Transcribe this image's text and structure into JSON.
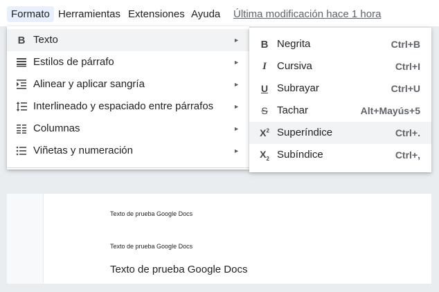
{
  "menubar": {
    "items": [
      "Formato",
      "Herramientas",
      "Extensiones",
      "Ayuda"
    ],
    "last_modified": "Última modificación hace 1 hora"
  },
  "format_menu": {
    "items": [
      {
        "label": "Texto",
        "icon": "bold-b-icon"
      },
      {
        "label": "Estilos de párrafo",
        "icon": "paragraph-styles-icon"
      },
      {
        "label": "Alinear y aplicar sangría",
        "icon": "indent-icon"
      },
      {
        "label": "Interlineado y espaciado entre párrafos",
        "icon": "line-spacing-icon"
      },
      {
        "label": "Columnas",
        "icon": "columns-icon"
      },
      {
        "label": "Viñetas y numeración",
        "icon": "bulleted-list-icon"
      }
    ],
    "arrow": "►"
  },
  "text_submenu": {
    "items": [
      {
        "label": "Negrita",
        "shortcut": "Ctrl+B",
        "icon": "bold-icon"
      },
      {
        "label": "Cursiva",
        "shortcut": "Ctrl+I",
        "icon": "italic-icon"
      },
      {
        "label": "Subrayar",
        "shortcut": "Ctrl+U",
        "icon": "underline-icon"
      },
      {
        "label": "Tachar",
        "shortcut": "Alt+Mayús+5",
        "icon": "strikethrough-icon"
      },
      {
        "label": "Superíndice",
        "shortcut": "Ctrl+.",
        "icon": "superscript-icon"
      },
      {
        "label": "Subíndice",
        "shortcut": "Ctrl+,",
        "icon": "subscript-icon"
      }
    ]
  },
  "document": {
    "lines": [
      "Texto de prueba Google Docs",
      "Texto de prueba Google Docs",
      "Texto de prueba Google Docs"
    ]
  },
  "colors": {
    "highlight": "#f1f3f4",
    "menubar_active": "#e8f0fe",
    "background": "#eaedf0"
  }
}
